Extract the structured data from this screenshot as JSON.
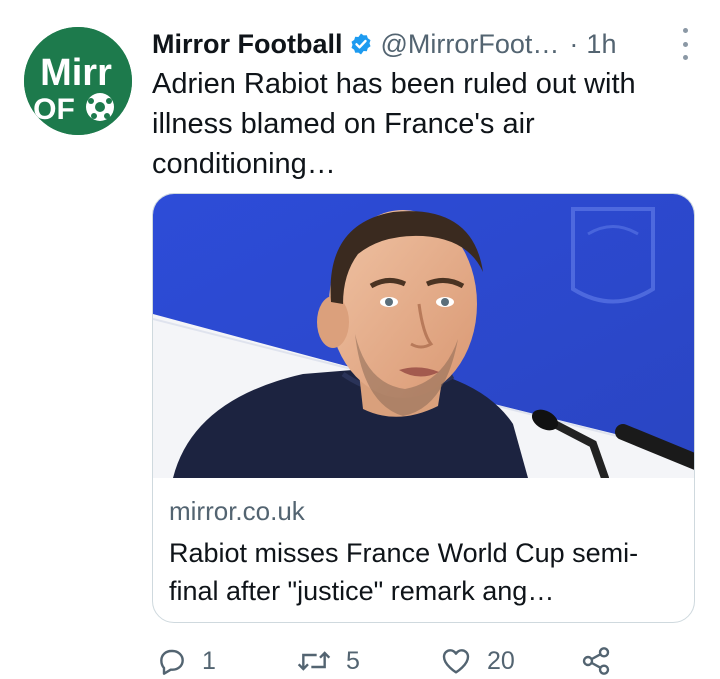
{
  "tweet": {
    "author_name": "Mirror Football",
    "handle": "@MirrorFoot…",
    "separator": "·",
    "time": "1h",
    "text": "Adrien Rabiot has been ruled out with illness blamed on France's air conditioning…",
    "avatar_logo_text": "Mirror"
  },
  "card": {
    "domain": "mirror.co.uk",
    "title": "Rabiot misses France World Cup semi-final after \"justice\" remark ang…"
  },
  "actions": {
    "replies": "1",
    "retweets": "5",
    "likes": "20"
  },
  "colors": {
    "avatar_green": "#1d7a4c",
    "verified_blue": "#1d9bf0",
    "muted_text": "#536471",
    "backdrop_blue": "#2f4fd6"
  },
  "icons": [
    "reply-icon",
    "retweet-icon",
    "like-icon",
    "share-icon",
    "verified-badge-icon",
    "more-icon"
  ]
}
